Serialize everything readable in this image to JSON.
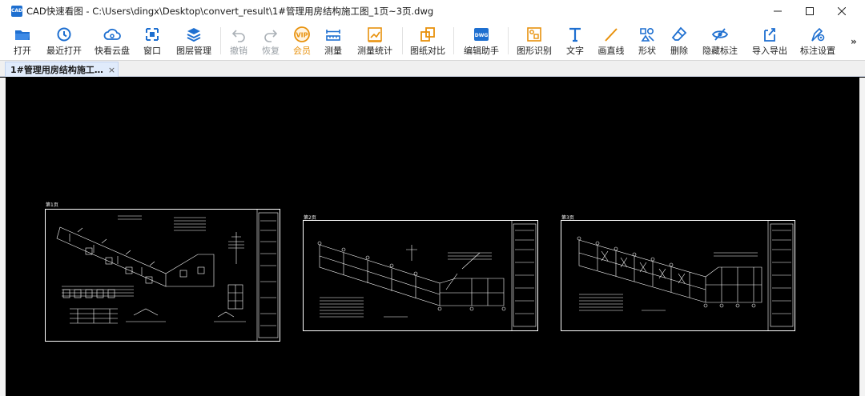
{
  "window": {
    "title": "CAD快速看图 - C:\\Users\\dingx\\Desktop\\convert_result\\1#管理用房结构施工图_1页~3页.dwg",
    "app_icon_text": "CAD"
  },
  "toolbar": {
    "items": [
      {
        "label": "打开",
        "icon": "folder-open-icon"
      },
      {
        "label": "最近打开",
        "icon": "history-icon"
      },
      {
        "label": "快看云盘",
        "icon": "cloud-icon"
      },
      {
        "label": "窗口",
        "icon": "window-icon"
      },
      {
        "label": "图层管理",
        "icon": "layers-icon"
      },
      {
        "label": "撤销",
        "icon": "undo-icon"
      },
      {
        "label": "恢复",
        "icon": "redo-icon"
      },
      {
        "label": "会员",
        "icon": "vip-icon"
      },
      {
        "label": "测量",
        "icon": "ruler-icon"
      },
      {
        "label": "测量统计",
        "icon": "measure-stats-icon"
      },
      {
        "label": "图纸对比",
        "icon": "compare-icon"
      },
      {
        "label": "编辑助手",
        "icon": "edit-assistant-icon"
      },
      {
        "label": "图形识别",
        "icon": "shape-recognize-icon"
      },
      {
        "label": "文字",
        "icon": "text-icon"
      },
      {
        "label": "画直线",
        "icon": "line-icon"
      },
      {
        "label": "形状",
        "icon": "shape-icon"
      },
      {
        "label": "删除",
        "icon": "eraser-icon"
      },
      {
        "label": "隐藏标注",
        "icon": "hide-eye-icon"
      },
      {
        "label": "导入导出",
        "icon": "import-export-icon"
      },
      {
        "label": "标注设置",
        "icon": "annotation-settings-icon"
      }
    ],
    "more_glyph": "»"
  },
  "tabs": [
    {
      "label": "1#管理用房结构施工…",
      "close": "×"
    }
  ],
  "sheets": [
    {
      "label": "第1页"
    },
    {
      "label": "第2页"
    },
    {
      "label": "第3页"
    }
  ],
  "colors": {
    "accent_blue": "#1e6fd0",
    "vip_orange": "#e8910c",
    "canvas": "#000000",
    "disabled": "#9aa0a6"
  }
}
